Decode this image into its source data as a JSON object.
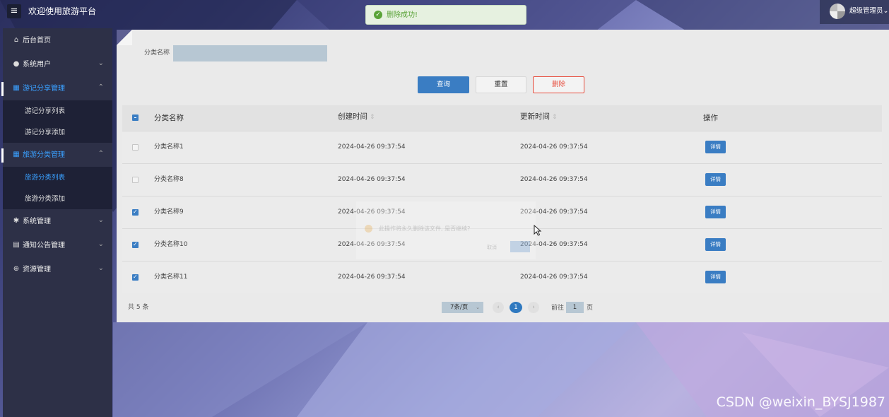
{
  "header": {
    "title": "欢迎使用旅游平台",
    "menu_icon": "hamburger-icon",
    "user_name": "超级管理员",
    "user_chevron": "chevron-down-icon"
  },
  "toast": {
    "text": "删除成功!",
    "icon": "success-check-icon",
    "color": "#5aa338"
  },
  "sidebar": {
    "items": [
      {
        "label": "后台首页",
        "icon": "home-icon"
      },
      {
        "label": "系统用户",
        "icon": "user-icon"
      },
      {
        "label": "游记分享管理",
        "icon": "grid-icon",
        "sub": [
          "游记分享列表",
          "游记分享添加"
        ]
      },
      {
        "label": "旅游分类管理",
        "icon": "grid-icon",
        "sub": [
          "旅游分类列表",
          "旅游分类添加"
        ]
      },
      {
        "label": "系统管理",
        "icon": "gear-icon"
      },
      {
        "label": "通知公告管理",
        "icon": "document-icon"
      },
      {
        "label": "资源管理",
        "icon": "plus-circle-icon"
      }
    ],
    "active_sub": "旅游分类列表",
    "accent": "#3aa0ff"
  },
  "search": {
    "label": "分类名称",
    "value": "",
    "query_label": "查询",
    "reset_label": "重置",
    "delete_label": "删除"
  },
  "table": {
    "columns": [
      "分类名称",
      "创建时间",
      "更新时间",
      "操作"
    ],
    "sort_icon": "⇕",
    "rows": [
      {
        "name": "分类名称1",
        "created": "2024-04-26 09:37:54",
        "updated": "2024-04-26 09:37:54",
        "checked": false,
        "action": "详情"
      },
      {
        "name": "分类名称8",
        "created": "2024-04-26 09:37:54",
        "updated": "2024-04-26 09:37:54",
        "checked": false,
        "action": "详情"
      },
      {
        "name": "分类名称9",
        "created": "2024-04-26 09:37:54",
        "updated": "2024-04-26 09:37:54",
        "checked": true,
        "action": "详情"
      },
      {
        "name": "分类名称10",
        "created": "2024-04-26 09:37:54",
        "updated": "2024-04-26 09:37:54",
        "checked": true,
        "action": "详情"
      },
      {
        "name": "分类名称11",
        "created": "2024-04-26 09:37:54",
        "updated": "2024-04-26 09:37:54",
        "checked": true,
        "action": "详情"
      }
    ]
  },
  "ghost_dialog": {
    "text": "此操作将永久删除该文件, 是否继续?",
    "cancel": "取消"
  },
  "pagination": {
    "total": "共 5 条",
    "page_size": "7条/页",
    "current": "1",
    "goto_pre": "前往",
    "goto_value": "1",
    "goto_post": "页"
  },
  "watermark": "CSDN @weixin_BYSJ1987"
}
